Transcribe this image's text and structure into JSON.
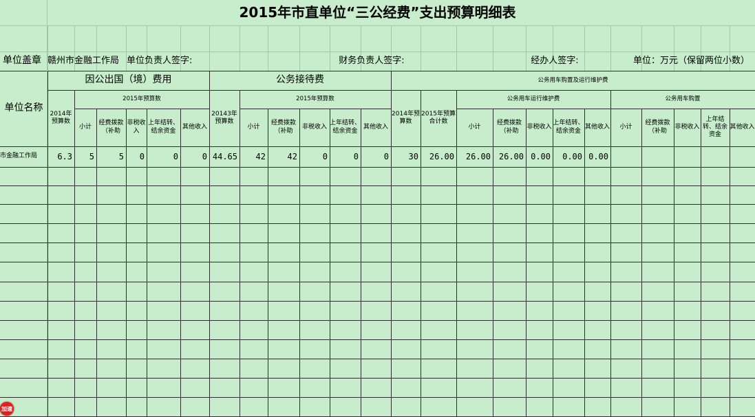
{
  "title": "2015年市直单位“三公经费”支出预算明细表",
  "info_row": {
    "stamp_label": "单位盖章",
    "unit_value": "赣州市金融工作局",
    "responsible_label": "单位负责人签字:",
    "finance_label": "财务负责人签字:",
    "handler_label": "经办人签字:",
    "unit_note": "单位：万元（保留两位小数）"
  },
  "headers": {
    "unit_name": "单位名称",
    "abroad_group": "因公出国（境）费用",
    "reception_group": "公务接待费",
    "vehicle_group": "公务用车购置及运行维护费",
    "abroad_2015": "2015年预算数",
    "reception_2015": "2015年预算数",
    "vehicle_run": "公务用车运行维护费",
    "vehicle_buy": "公务用车购置",
    "col_2014_budget": "2014年预算数",
    "col_20143_budget": "20143年预算数",
    "col_2014_v": "2014年预算数",
    "col_2015_total": "2015年预算合计数",
    "subtotal": "小计",
    "appropriation": "经费拨款（补助",
    "nontax": "非税收入",
    "carryover": "上年结转、结余资金",
    "other": "其他收入"
  },
  "rows": [
    [
      "市金融工作局",
      "6.3",
      "5",
      "5",
      "0",
      "0",
      "0",
      "44.65",
      "42",
      "42",
      "0",
      "0",
      "0",
      "30",
      "26.00",
      "26.00",
      "26.00",
      "0.00",
      "0.00",
      "0.00",
      "",
      "",
      "",
      "",
      ""
    ]
  ],
  "badge_text": "加速"
}
